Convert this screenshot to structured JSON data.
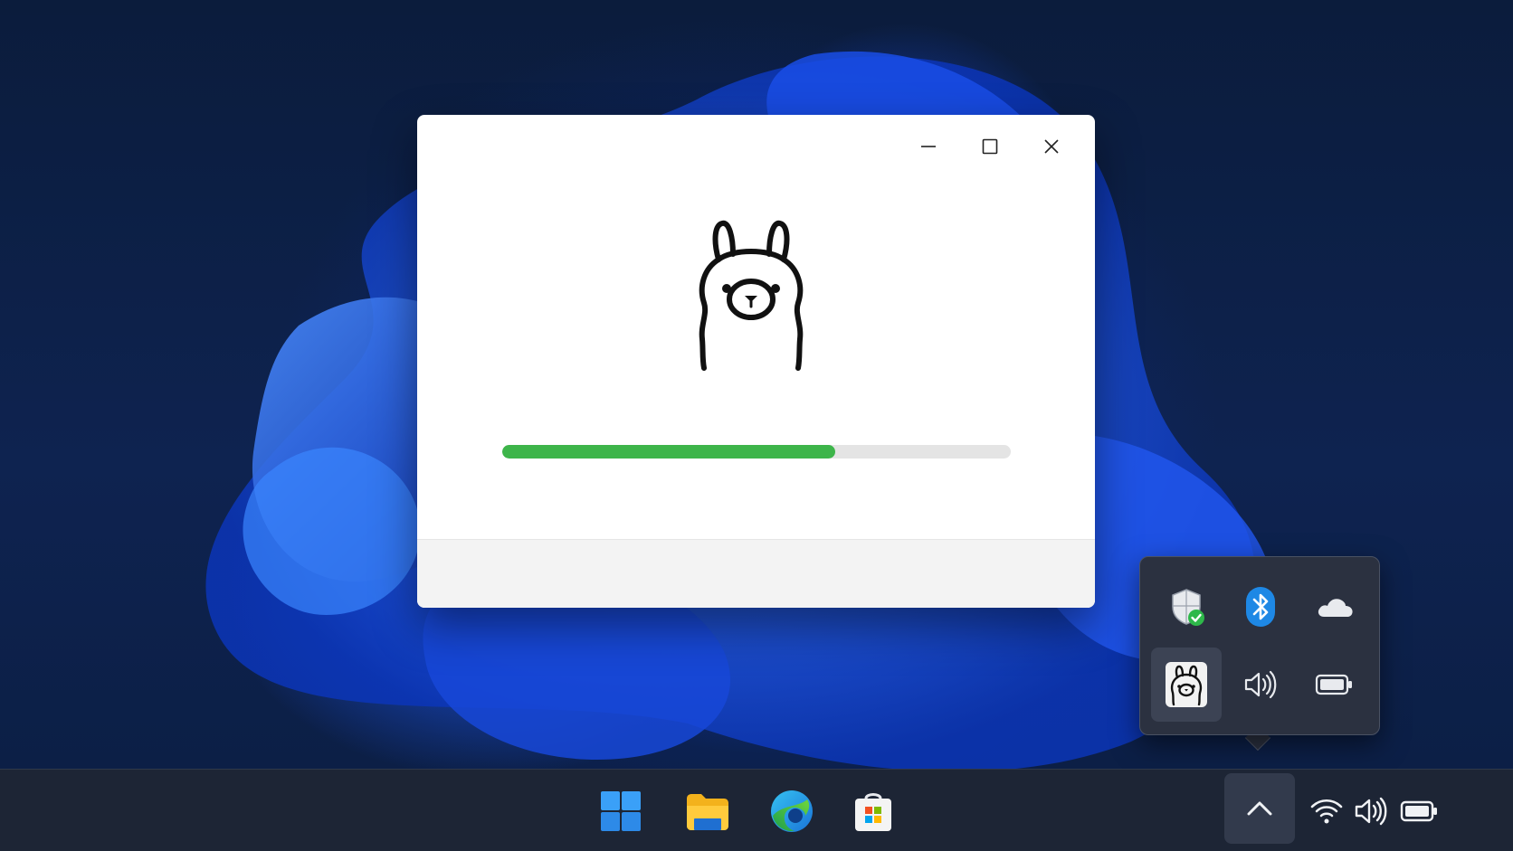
{
  "window": {
    "controls": [
      "minimize-icon",
      "maximize-icon",
      "close-icon"
    ],
    "logo": "llama-logo",
    "progress_fraction": 0.655,
    "progress_color": "#3db54a",
    "track_color": "#e4e4e4"
  },
  "tray_flyout": {
    "items": [
      "windows-security-icon",
      "bluetooth-icon",
      "onedrive-icon",
      "ollama-tray-icon",
      "volume-icon",
      "battery-icon"
    ],
    "accent": "#1e88e5",
    "security_badge_color": "#2eb84a"
  },
  "taskbar": {
    "pinned": [
      "start-icon",
      "file-explorer-icon",
      "edge-icon",
      "microsoft-store-icon"
    ],
    "system_tray": [
      "show-hidden-icons-chevron",
      "wifi-icon",
      "volume-icon",
      "battery-icon"
    ]
  }
}
